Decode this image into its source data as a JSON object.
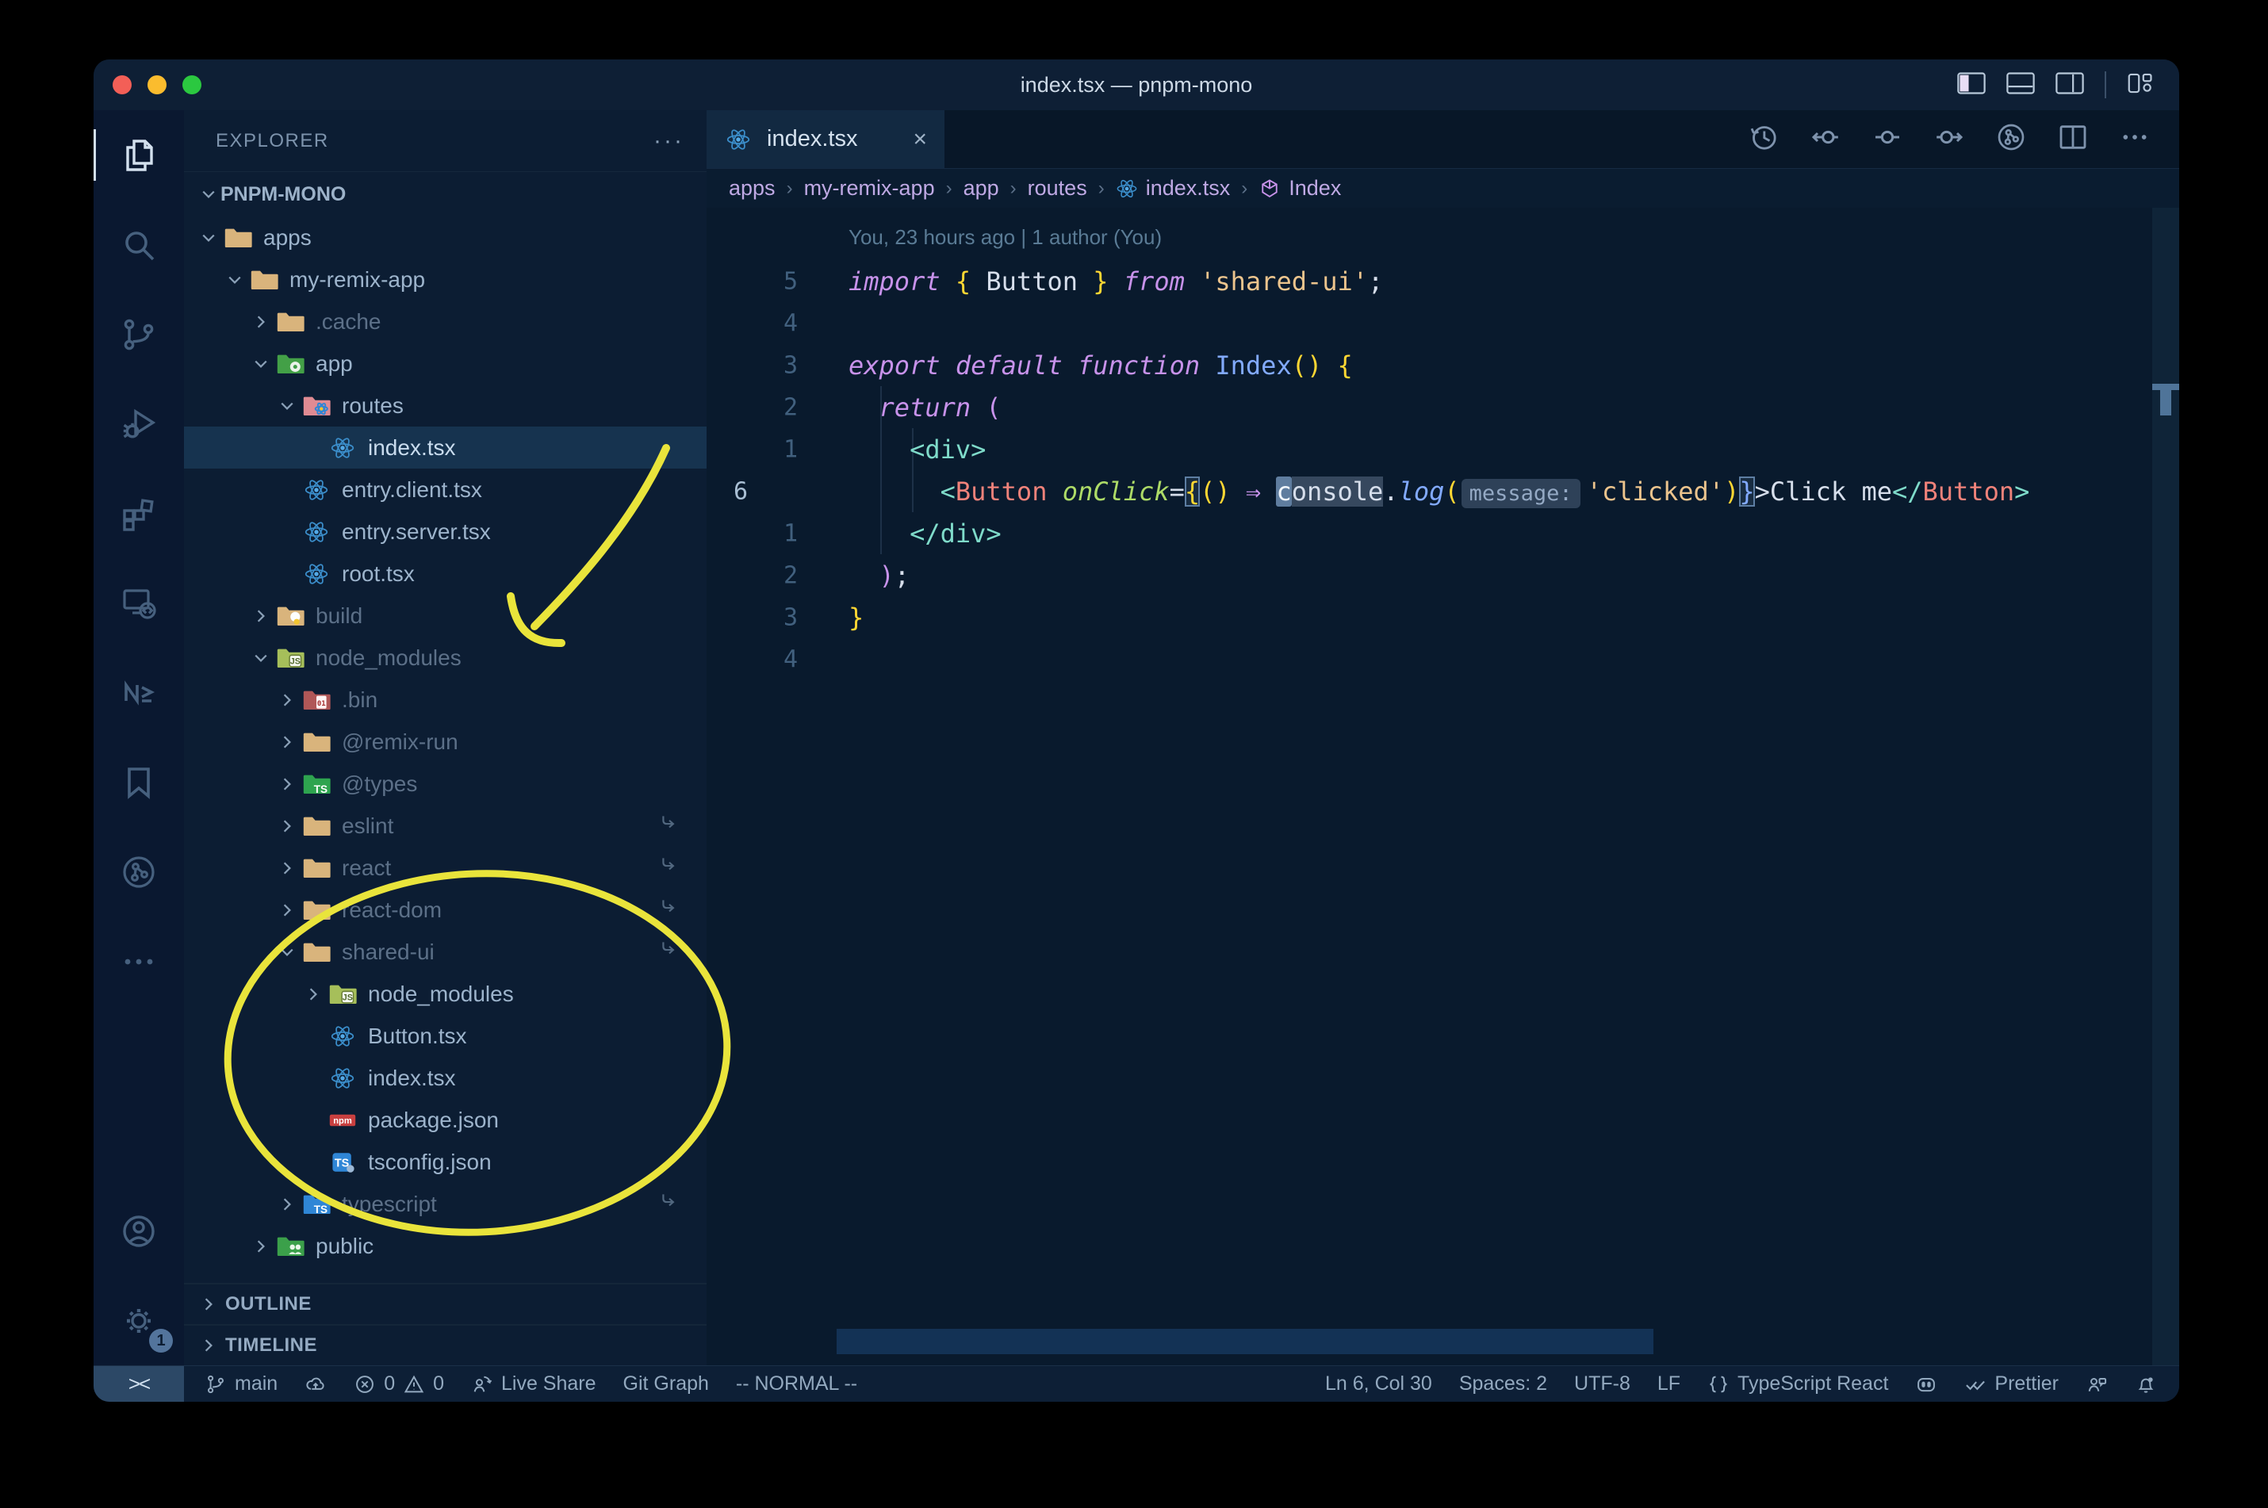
{
  "window": {
    "title": "index.tsx — pnpm-mono"
  },
  "titlebar_actions": [
    {
      "name": "layout-sidebar-left-toggle"
    },
    {
      "name": "layout-panel-toggle"
    },
    {
      "name": "layout-sidebar-right-toggle"
    },
    {
      "name": "layout-customize"
    }
  ],
  "activity_bar": {
    "top": [
      {
        "name": "explorer",
        "icon": "files",
        "active": true
      },
      {
        "name": "search",
        "icon": "search",
        "active": false
      },
      {
        "name": "source-control",
        "icon": "scm",
        "active": false
      },
      {
        "name": "run-debug",
        "icon": "debug",
        "active": false
      },
      {
        "name": "extensions",
        "icon": "extensions",
        "active": false
      },
      {
        "name": "remote-explorer",
        "icon": "remote",
        "active": false
      },
      {
        "name": "nx-console",
        "icon": "nx",
        "active": false
      },
      {
        "name": "bookmarks",
        "icon": "bookmark",
        "active": false
      },
      {
        "name": "git-graph",
        "icon": "gitgraph",
        "active": false
      },
      {
        "name": "more-views",
        "icon": "more",
        "active": false
      }
    ],
    "bottom": [
      {
        "name": "accounts",
        "icon": "account"
      },
      {
        "name": "settings",
        "icon": "gear",
        "badge": "1"
      }
    ]
  },
  "explorer": {
    "title": "EXPLORER",
    "more_label": "···",
    "section": "PNPM-MONO",
    "tree": [
      {
        "label": "apps",
        "depth": 0,
        "chevron": "down",
        "icon": "folder-tan"
      },
      {
        "label": "my-remix-app",
        "depth": 1,
        "chevron": "down",
        "icon": "folder-tan"
      },
      {
        "label": ".cache",
        "depth": 2,
        "chevron": "right",
        "icon": "folder-tan",
        "dim": true
      },
      {
        "label": "app",
        "depth": 2,
        "chevron": "down",
        "icon": "folder-app"
      },
      {
        "label": "routes",
        "depth": 3,
        "chevron": "down",
        "icon": "folder-routes"
      },
      {
        "label": "index.tsx",
        "depth": 4,
        "chevron": "none",
        "icon": "react",
        "selected": true
      },
      {
        "label": "entry.client.tsx",
        "depth": 3,
        "chevron": "none",
        "icon": "react"
      },
      {
        "label": "entry.server.tsx",
        "depth": 3,
        "chevron": "none",
        "icon": "react"
      },
      {
        "label": "root.tsx",
        "depth": 3,
        "chevron": "none",
        "icon": "react"
      },
      {
        "label": "build",
        "depth": 2,
        "chevron": "right",
        "icon": "folder-build",
        "dim": true
      },
      {
        "label": "node_modules",
        "depth": 2,
        "chevron": "down",
        "icon": "folder-node",
        "dim": true
      },
      {
        "label": ".bin",
        "depth": 3,
        "chevron": "right",
        "icon": "folder-bin",
        "dim": true
      },
      {
        "label": "@remix-run",
        "depth": 3,
        "chevron": "right",
        "icon": "folder-tan",
        "dim": true
      },
      {
        "label": "@types",
        "depth": 3,
        "chevron": "right",
        "icon": "folder-ts-green",
        "dim": true
      },
      {
        "label": "eslint",
        "depth": 3,
        "chevron": "right",
        "icon": "folder-tan",
        "dim": true,
        "symlink": true
      },
      {
        "label": "react",
        "depth": 3,
        "chevron": "right",
        "icon": "folder-tan",
        "dim": true,
        "symlink": true
      },
      {
        "label": "react-dom",
        "depth": 3,
        "chevron": "right",
        "icon": "folder-tan",
        "dim": true,
        "symlink": true
      },
      {
        "label": "shared-ui",
        "depth": 3,
        "chevron": "down",
        "icon": "folder-tan",
        "dim": true,
        "symlink": true
      },
      {
        "label": "node_modules",
        "depth": 4,
        "chevron": "right",
        "icon": "folder-node"
      },
      {
        "label": "Button.tsx",
        "depth": 4,
        "chevron": "none",
        "icon": "react"
      },
      {
        "label": "index.tsx",
        "depth": 4,
        "chevron": "none",
        "icon": "react"
      },
      {
        "label": "package.json",
        "depth": 4,
        "chevron": "none",
        "icon": "npm"
      },
      {
        "label": "tsconfig.json",
        "depth": 4,
        "chevron": "none",
        "icon": "ts"
      },
      {
        "label": "typescript",
        "depth": 3,
        "chevron": "right",
        "icon": "folder-ts-blue",
        "dim": true,
        "symlink": true
      },
      {
        "label": "public",
        "depth": 2,
        "chevron": "right",
        "icon": "folder-public"
      }
    ],
    "panels": [
      "OUTLINE",
      "TIMELINE"
    ]
  },
  "tab": {
    "label": "index.tsx",
    "icon": "react",
    "close": "×"
  },
  "editor_actions": [
    {
      "name": "timeline-history",
      "icon": "history"
    },
    {
      "name": "previous-change",
      "icon": "prev-change"
    },
    {
      "name": "current-change",
      "icon": "change"
    },
    {
      "name": "next-change",
      "icon": "next-change"
    },
    {
      "name": "git-graph-view",
      "icon": "gitgraph"
    },
    {
      "name": "split-editor",
      "icon": "split"
    },
    {
      "name": "more-actions",
      "icon": "more"
    }
  ],
  "breadcrumbs": [
    {
      "label": "apps"
    },
    {
      "label": "my-remix-app"
    },
    {
      "label": "app"
    },
    {
      "label": "routes"
    },
    {
      "label": "index.tsx",
      "icon": "react"
    },
    {
      "label": "Index",
      "icon": "cube"
    }
  ],
  "code": {
    "codelens": "You, 23 hours ago | 1 author (You)",
    "lines": [
      {
        "n": "5",
        "tokens": [
          [
            "kw",
            "import"
          ],
          [
            "w",
            " "
          ],
          [
            "y",
            "{"
          ],
          [
            "w",
            " Button "
          ],
          [
            "y",
            "}"
          ],
          [
            "w",
            " "
          ],
          [
            "kw",
            "from"
          ],
          [
            "w",
            " "
          ],
          [
            "str",
            "'shared-ui'"
          ],
          [
            "w",
            ";"
          ]
        ]
      },
      {
        "n": "4",
        "tokens": []
      },
      {
        "n": "3",
        "tokens": [
          [
            "kw",
            "export"
          ],
          [
            "w",
            " "
          ],
          [
            "kw",
            "default"
          ],
          [
            "w",
            " "
          ],
          [
            "kw",
            "function"
          ],
          [
            "w",
            " "
          ],
          [
            "blue2",
            "Index"
          ],
          [
            "y",
            "()"
          ],
          [
            "w",
            " "
          ],
          [
            "y",
            "{"
          ]
        ]
      },
      {
        "n": "2",
        "tokens": [
          [
            "w",
            "  "
          ],
          [
            "kw",
            "return"
          ],
          [
            "w",
            " "
          ],
          [
            "pnk",
            "("
          ]
        ]
      },
      {
        "n": "1",
        "tokens": [
          [
            "w",
            "    "
          ],
          [
            "teal",
            "<div>"
          ]
        ]
      },
      {
        "n": "6",
        "current": true,
        "tokens": [
          [
            "w",
            "      "
          ],
          [
            "teal",
            "<"
          ],
          [
            "coral",
            "Button"
          ],
          [
            "w",
            " "
          ],
          [
            "attr",
            "onClick"
          ],
          [
            "w",
            "="
          ],
          [
            "ybox",
            "{"
          ],
          [
            "y",
            "()"
          ],
          [
            "w",
            " "
          ],
          [
            "arrow",
            "⇒"
          ],
          [
            "w",
            " "
          ],
          [
            "cur",
            "c"
          ],
          [
            "sel",
            "onsole"
          ],
          [
            "w",
            "."
          ],
          [
            "blue",
            "log"
          ],
          [
            "y",
            "("
          ],
          [
            "inlay",
            "message:"
          ],
          [
            "str",
            "'clicked'"
          ],
          [
            "y",
            ")"
          ],
          [
            "bbox",
            "}"
          ],
          [
            "w",
            ">"
          ],
          [
            "w",
            "Click me"
          ],
          [
            "teal",
            "</"
          ],
          [
            "coral",
            "Button"
          ],
          [
            "teal",
            ">"
          ]
        ]
      },
      {
        "n": "1",
        "tokens": [
          [
            "w",
            "    "
          ],
          [
            "teal",
            "</div>"
          ]
        ]
      },
      {
        "n": "2",
        "tokens": [
          [
            "w",
            "  "
          ],
          [
            "pnk",
            ")"
          ],
          [
            "w",
            ";"
          ]
        ]
      },
      {
        "n": "3",
        "tokens": [
          [
            "y",
            "}"
          ]
        ]
      },
      {
        "n": "4",
        "tokens": []
      }
    ]
  },
  "status_bar": {
    "remote": "><",
    "left": [
      {
        "name": "git-branch",
        "icon": "branch",
        "label": "main"
      },
      {
        "name": "sync",
        "icon": "cloud",
        "label": ""
      },
      {
        "name": "problems",
        "icon": "error",
        "label": "0",
        "icon2": "warn",
        "label2": "0"
      },
      {
        "name": "live-share",
        "icon": "liveshare",
        "label": "Live Share"
      },
      {
        "name": "git-graph",
        "label": "Git Graph"
      },
      {
        "name": "vim-mode",
        "label": "-- NORMAL --"
      }
    ],
    "right": [
      {
        "name": "cursor-position",
        "label": "Ln 6, Col 30"
      },
      {
        "name": "indentation",
        "label": "Spaces: 2"
      },
      {
        "name": "encoding",
        "label": "UTF-8"
      },
      {
        "name": "eol",
        "label": "LF"
      },
      {
        "name": "language-mode",
        "icon": "braces",
        "label": "TypeScript React"
      },
      {
        "name": "copilot",
        "icon": "copilot",
        "label": ""
      },
      {
        "name": "prettier",
        "icon": "check2",
        "label": "Prettier"
      },
      {
        "name": "feedback",
        "icon": "feedback",
        "label": ""
      },
      {
        "name": "notifications",
        "icon": "bell",
        "label": ""
      }
    ]
  },
  "annotation_color": "#e9e43b"
}
